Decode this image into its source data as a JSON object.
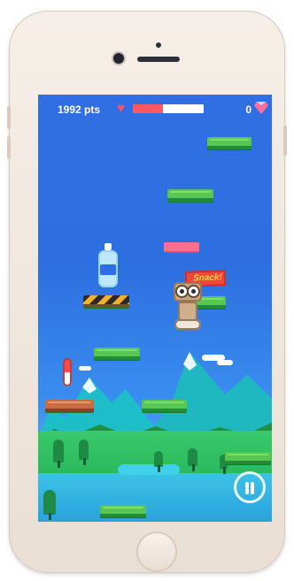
{
  "hud": {
    "score_label": "1992 pts",
    "health_percent": 0.42,
    "gems_label": "0"
  },
  "items": {
    "snack_text": "Snack!"
  },
  "icons": {
    "heart": "heart-icon",
    "gem": "gem-icon",
    "pause": "pause-button"
  },
  "colors": {
    "sky": "#2f6fe3",
    "health_fill": "#ff5862",
    "gem": "#ff6f9c",
    "platform_green": "#58c653"
  }
}
